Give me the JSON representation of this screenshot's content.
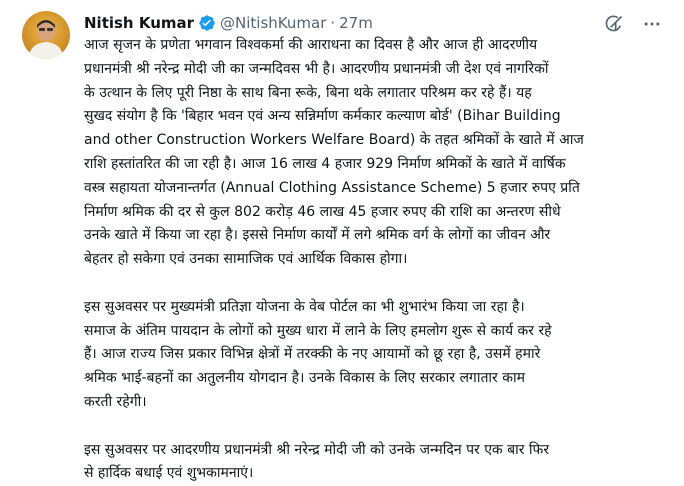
{
  "tweet": {
    "author": "Nitish Kumar",
    "handle": "@NitishKumar",
    "separator": "·",
    "time": "27m",
    "lines": [
      "आज सृजन के प्रणेता भगवान विश्वकर्मा की आराधना का दिवस है और आज ही आदरणीय",
      "प्रधानमंत्री श्री नरेन्द्र मोदी जी का जन्मदिवस भी है। आदरणीय प्रधानमंत्री जी देश एवं नागरिकों",
      "के उत्थान के लिए पूरी निष्ठा के साथ बिना रूके, बिना थके लगातार परिश्रम कर रहे हैं। यह",
      "सुखद संयोग है कि 'बिहार भवन एवं अन्य सन्निर्माण कर्मकार कल्याण बोर्ड' (Bihar Building",
      "and other Construction Workers Welfare Board) के तहत श्रमिकों के खाते में आज",
      "राशि हस्तांतरित की जा रही है। आज 16 लाख 4 हजार 929 निर्माण श्रमिकों के खाते में वार्षिक",
      "वस्त्र सहायता योजनान्तर्गत (Annual Clothing Assistance Scheme) 5 हजार रुपए प्रति",
      "निर्माण श्रमिक की दर से कुल 802 करोड़ 46 लाख 45 हजार रुपए की राशि का अन्तरण सीधे",
      "उनके खाते में किया जा रहा है। इससे निर्माण कार्यों में लगे श्रमिक वर्ग के लोगों का जीवन और",
      "बेहतर हो सकेगा एवं उनका सामाजिक एवं आर्थिक विकास होगा।",
      "",
      "इस सुअवसर पर मुख्यमंत्री प्रतिज्ञा योजना के वेब पोर्टल का भी शुभारंभ किया जा रहा है।",
      "समाज के अंतिम पायदान के लोगों को मुख्य धारा में लाने के लिए हमलोग शुरू से कार्य कर रहे",
      "हैं। आज राज्य जिस प्रकार विभिन्न क्षेत्रों में तरक्की के नए आयामों को छू रहा है, उसमें हमारे",
      "श्रमिक भाई-बहनों का अतुलनीय योगदान है। उनके विकास के लिए सरकार लगातार काम",
      "करती रहेगी।",
      "",
      "इस सुअवसर पर आदरणीय प्रधानमंत्री श्री नरेन्द्र मोदी जी को उनके जन्मदिन पर एक बार फिर",
      "से हार्दिक बधाई एवं शुभकामनाएं।"
    ]
  },
  "icons": {
    "verified": "verified-badge-icon",
    "grok": "grok-icon",
    "more": "more-options-icon"
  },
  "colors": {
    "verified": "#1d9bf0",
    "text": "#0f1419",
    "secondary": "#536471"
  }
}
